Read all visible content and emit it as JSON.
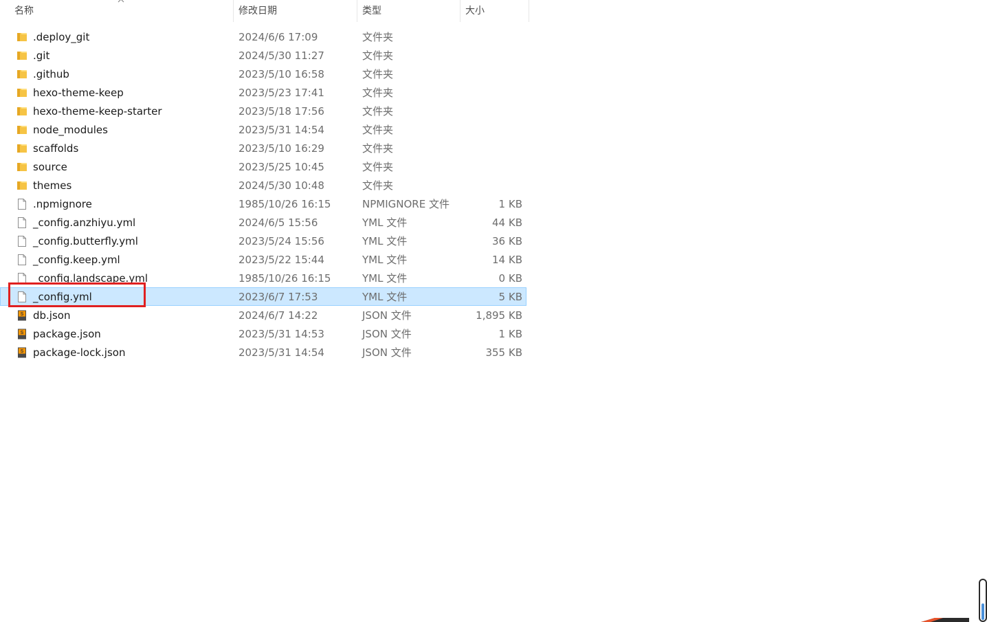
{
  "columns": {
    "name": "名称",
    "date": "修改日期",
    "type": "类型",
    "size": "大小"
  },
  "sort": {
    "column": "name",
    "direction": "ascending",
    "icon": "chevron-up-icon"
  },
  "files": [
    {
      "name": ".deploy_git",
      "date": "2024/6/6 17:09",
      "type": "文件夹",
      "size": "",
      "icon": "folder-icon"
    },
    {
      "name": ".git",
      "date": "2024/5/30 11:27",
      "type": "文件夹",
      "size": "",
      "icon": "folder-icon"
    },
    {
      "name": ".github",
      "date": "2023/5/10 16:58",
      "type": "文件夹",
      "size": "",
      "icon": "folder-icon"
    },
    {
      "name": "hexo-theme-keep",
      "date": "2023/5/23 17:41",
      "type": "文件夹",
      "size": "",
      "icon": "folder-icon"
    },
    {
      "name": "hexo-theme-keep-starter",
      "date": "2023/5/18 17:56",
      "type": "文件夹",
      "size": "",
      "icon": "folder-icon"
    },
    {
      "name": "node_modules",
      "date": "2023/5/31 14:54",
      "type": "文件夹",
      "size": "",
      "icon": "folder-icon"
    },
    {
      "name": "scaffolds",
      "date": "2023/5/10 16:29",
      "type": "文件夹",
      "size": "",
      "icon": "folder-icon"
    },
    {
      "name": "source",
      "date": "2023/5/25 10:45",
      "type": "文件夹",
      "size": "",
      "icon": "folder-icon"
    },
    {
      "name": "themes",
      "date": "2024/5/30 10:48",
      "type": "文件夹",
      "size": "",
      "icon": "folder-icon"
    },
    {
      "name": ".npmignore",
      "date": "1985/10/26 16:15",
      "type": "NPMIGNORE 文件",
      "size": "1 KB",
      "icon": "file-icon"
    },
    {
      "name": "_config.anzhiyu.yml",
      "date": "2024/6/5 15:56",
      "type": "YML 文件",
      "size": "44 KB",
      "icon": "file-icon"
    },
    {
      "name": "_config.butterfly.yml",
      "date": "2023/5/24 15:56",
      "type": "YML 文件",
      "size": "36 KB",
      "icon": "file-icon"
    },
    {
      "name": "_config.keep.yml",
      "date": "2023/5/22 15:44",
      "type": "YML 文件",
      "size": "14 KB",
      "icon": "file-icon"
    },
    {
      "name": "_config.landscape.yml",
      "date": "1985/10/26 16:15",
      "type": "YML 文件",
      "size": "0 KB",
      "icon": "file-icon"
    },
    {
      "name": "_config.yml",
      "date": "2023/6/7 17:53",
      "type": "YML 文件",
      "size": "5 KB",
      "icon": "file-icon",
      "selected": true
    },
    {
      "name": "db.json",
      "date": "2024/6/7 14:22",
      "type": "JSON 文件",
      "size": "1,895 KB",
      "icon": "sublime-file-icon"
    },
    {
      "name": "package.json",
      "date": "2023/5/31 14:53",
      "type": "JSON 文件",
      "size": "1 KB",
      "icon": "sublime-file-icon"
    },
    {
      "name": "package-lock.json",
      "date": "2023/5/31 14:54",
      "type": "JSON 文件",
      "size": "355 KB",
      "icon": "sublime-file-icon"
    }
  ],
  "colors": {
    "selection_bg": "#cce8ff",
    "selection_border": "#99d1ff",
    "highlight_box": "#e02020",
    "folder": "#f6c445"
  }
}
